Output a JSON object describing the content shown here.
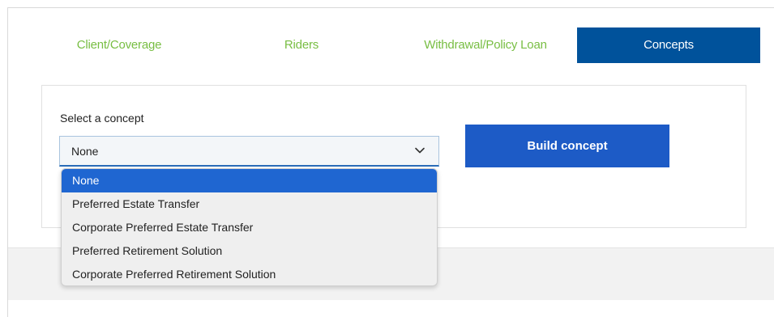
{
  "tabs": [
    {
      "label": "Client/Coverage",
      "active": false
    },
    {
      "label": "Riders",
      "active": false
    },
    {
      "label": "Withdrawal/Policy Loan",
      "active": false
    },
    {
      "label": "Concepts",
      "active": true
    }
  ],
  "concept": {
    "label": "Select a concept",
    "selected_value": "None",
    "build_button": "Build concept",
    "options": [
      {
        "label": "None",
        "selected": true
      },
      {
        "label": "Preferred Estate Transfer",
        "selected": false
      },
      {
        "label": "Corporate Preferred Estate Transfer",
        "selected": false
      },
      {
        "label": "Preferred Retirement Solution",
        "selected": false
      },
      {
        "label": "Corporate Preferred Retirement Solution",
        "selected": false
      }
    ]
  },
  "colors": {
    "tab_text": "#78be43",
    "active_tab_bg": "#00529b",
    "button_bg": "#1d5bc6",
    "selected_option_bg": "#1f66d1"
  },
  "icons": {
    "select_arrow": "chevron-down-icon"
  }
}
